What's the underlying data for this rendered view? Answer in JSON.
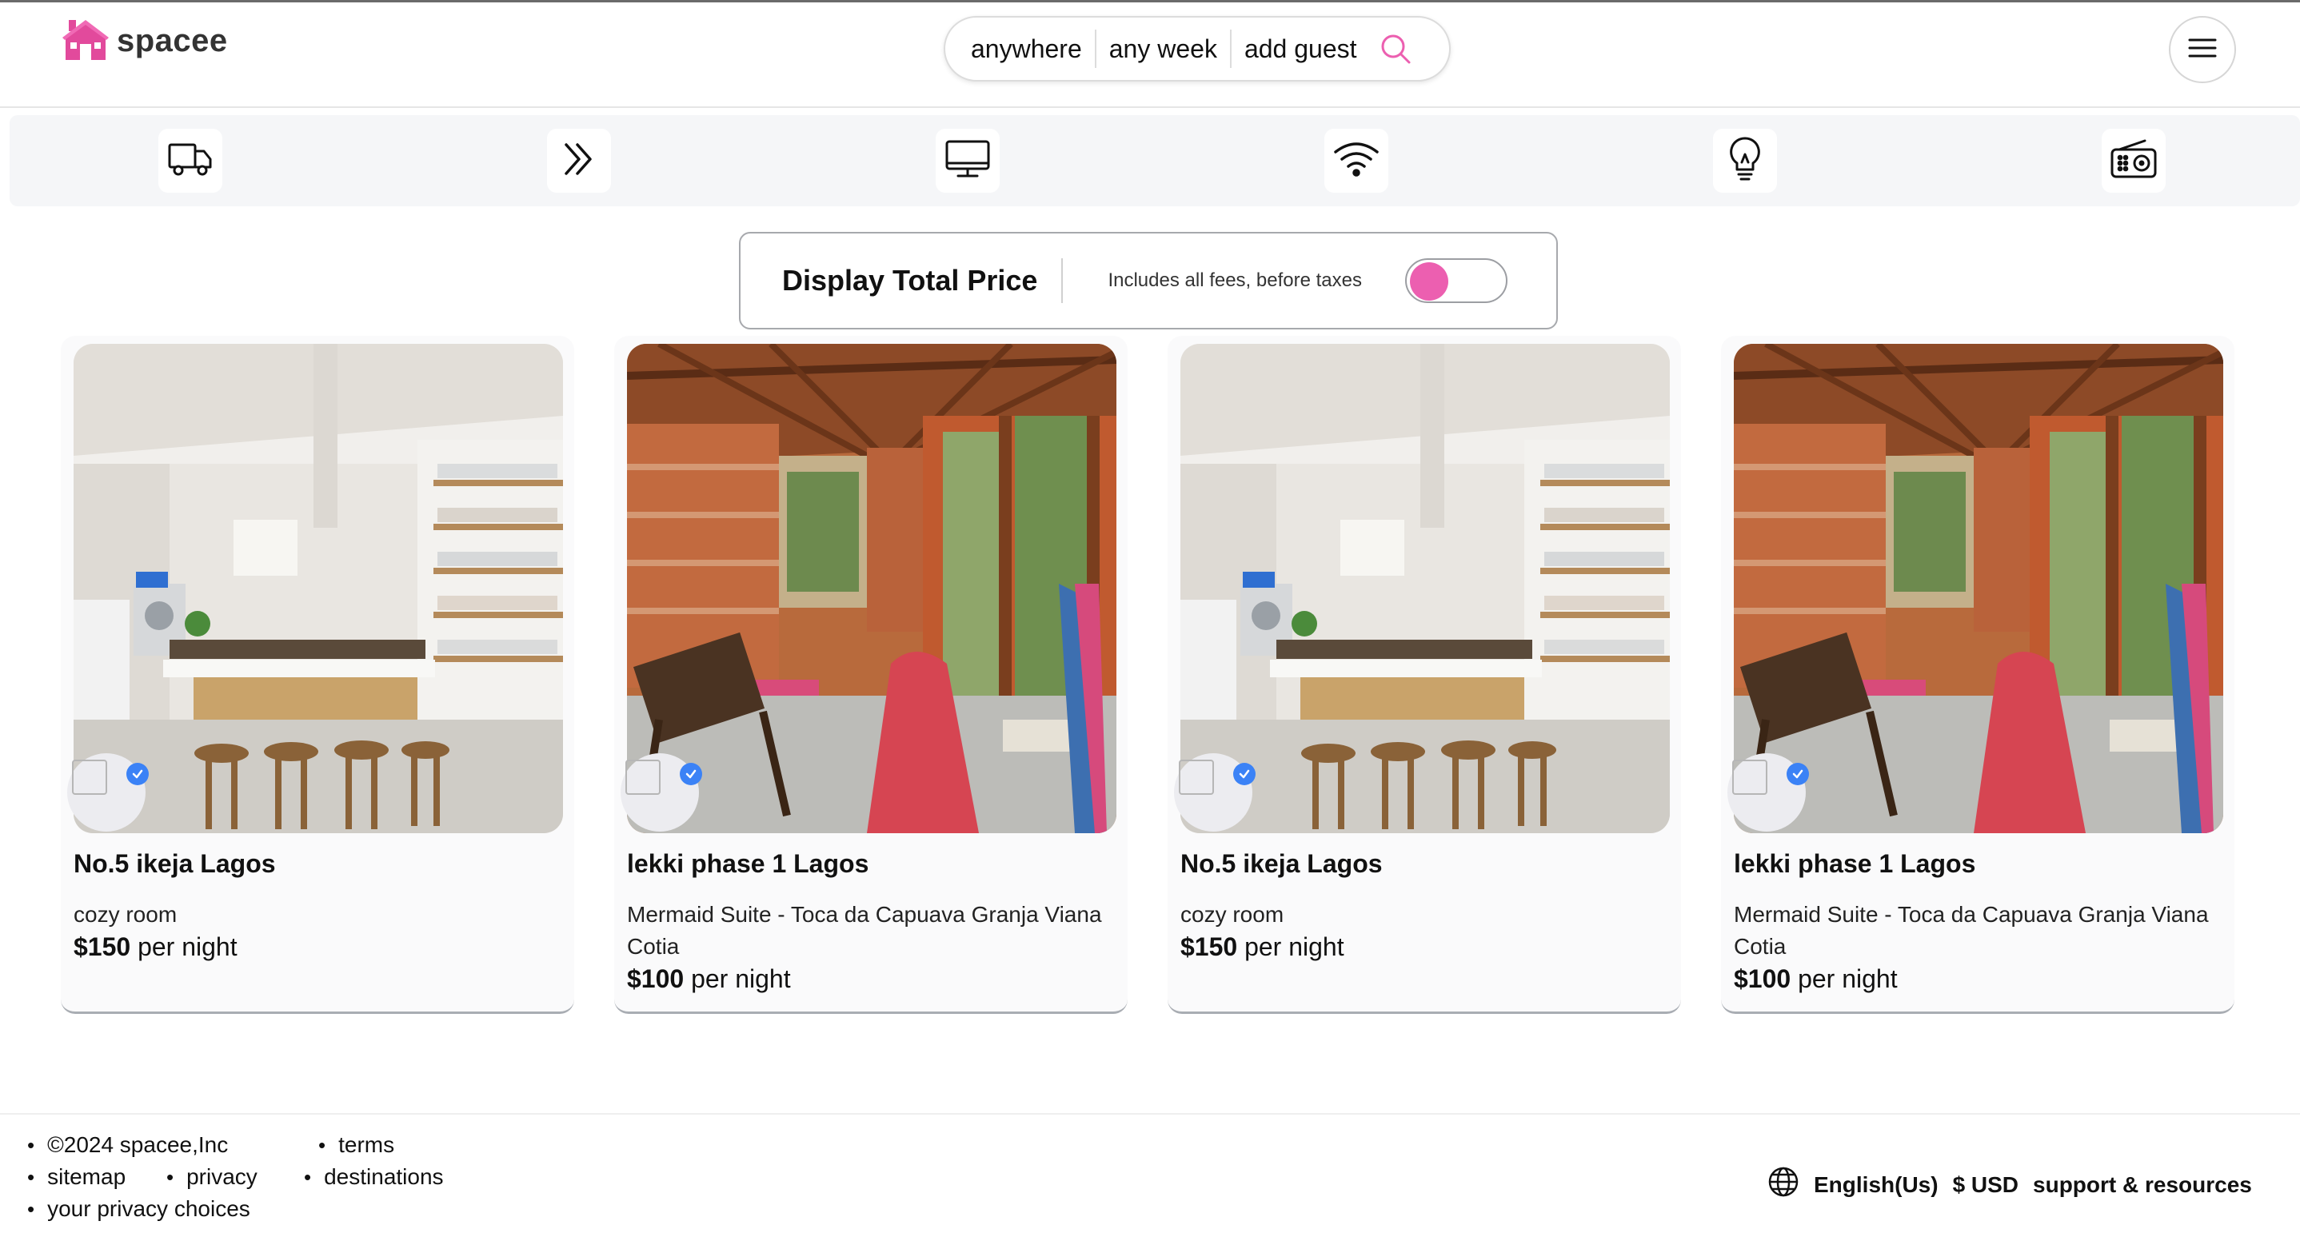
{
  "brand": {
    "name": "spacee",
    "accent": "#ec5fb0"
  },
  "search": {
    "anywhere": "anywhere",
    "week": "any week",
    "guest": "add guest"
  },
  "categories": [
    {
      "icon": "truck-icon"
    },
    {
      "icon": "double-chevron-right-icon"
    },
    {
      "icon": "monitor-icon"
    },
    {
      "icon": "wifi-icon"
    },
    {
      "icon": "lightbulb-icon"
    },
    {
      "icon": "radio-icon"
    }
  ],
  "price_toggle": {
    "title": "Display Total Price",
    "subtitle": "Includes all fees, before taxes",
    "enabled": false
  },
  "listings": [
    {
      "title": "No.5 ikeja Lagos",
      "description": "cozy room",
      "price": "$150",
      "unit": "per night",
      "photo": "kitchen"
    },
    {
      "title": "lekki phase 1 Lagos",
      "description": "Mermaid Suite - Toca da Capuava Granja Viana Cotia",
      "price": "$100",
      "unit": "per night",
      "photo": "sunroom"
    },
    {
      "title": "No.5 ikeja Lagos",
      "description": "cozy room",
      "price": "$150",
      "unit": "per night",
      "photo": "kitchen"
    },
    {
      "title": "lekki phase 1 Lagos",
      "description": "Mermaid Suite - Toca da Capuava Granja Viana Cotia",
      "price": "$100",
      "unit": "per night",
      "photo": "sunroom"
    }
  ],
  "footer": {
    "copyright": "©2024 spacee,Inc",
    "terms": "terms",
    "sitemap": "sitemap",
    "privacy": "privacy",
    "destinations": "destinations",
    "privacy_choices": "your privacy choices",
    "language": "English(Us)",
    "currency": "$ USD",
    "support": "support & resources"
  }
}
